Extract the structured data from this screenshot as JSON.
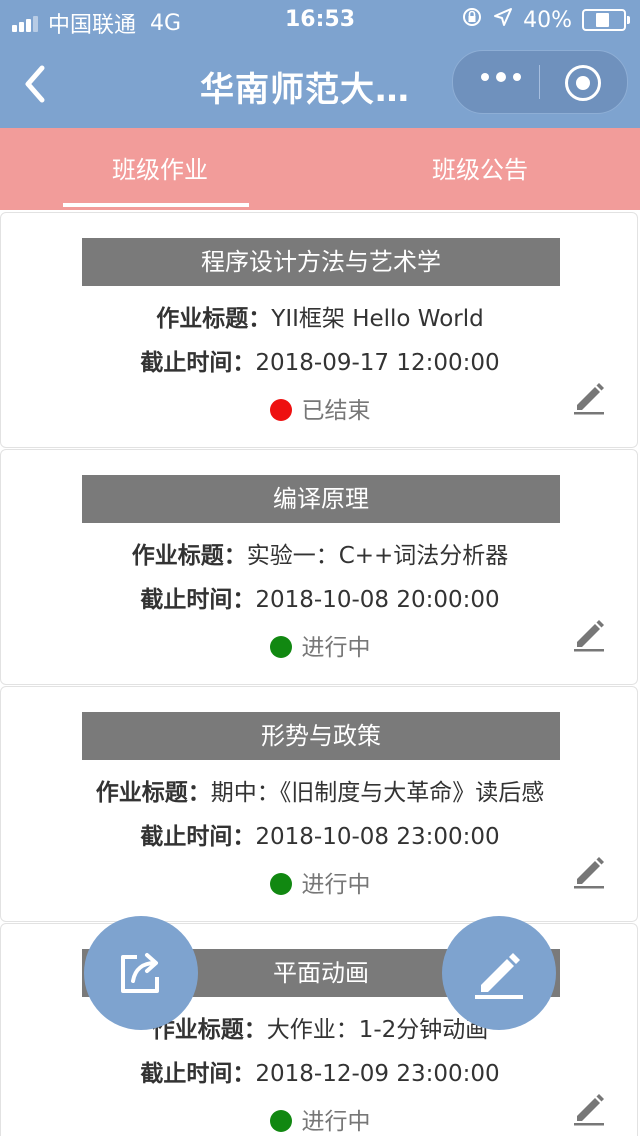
{
  "status_bar": {
    "carrier": "中国联通",
    "network": "4G",
    "time": "16:53",
    "battery": "40%",
    "battery_level": 0.4
  },
  "nav": {
    "title": "华南师范大…",
    "back_icon": "chevron-left-icon",
    "more_icon": "more-dots-icon",
    "close_icon": "target-circle-icon"
  },
  "tabs": [
    {
      "label": "班级作业",
      "active": true
    },
    {
      "label": "班级公告",
      "active": false
    }
  ],
  "labels": {
    "title_label": "作业标题：",
    "deadline_label": "截止时间："
  },
  "assignments": [
    {
      "course": "程序设计方法与艺术学",
      "title": "YII框架 Hello World",
      "deadline": "2018-09-17 12:00:00",
      "status": "已结束",
      "status_color": "#ee1010"
    },
    {
      "course": "编译原理",
      "title": "实验一：C++词法分析器",
      "deadline": "2018-10-08 20:00:00",
      "status": "进行中",
      "status_color": "#118811"
    },
    {
      "course": "形势与政策",
      "title": "期中：《旧制度与大革命》读后感",
      "deadline": "2018-10-08 23:00:00",
      "status": "进行中",
      "status_color": "#118811"
    },
    {
      "course": "平面动画",
      "title": "大作业：1-2分钟动画",
      "deadline": "2018-12-09 23:00:00",
      "status": "进行中",
      "status_color": "#118811"
    }
  ],
  "colors": {
    "header": "#7ea3cf",
    "tabs": "#f29c9a",
    "course_bar": "#7a7a7a"
  },
  "fabs": {
    "share_icon": "share-icon",
    "edit_icon": "pencil-icon"
  }
}
